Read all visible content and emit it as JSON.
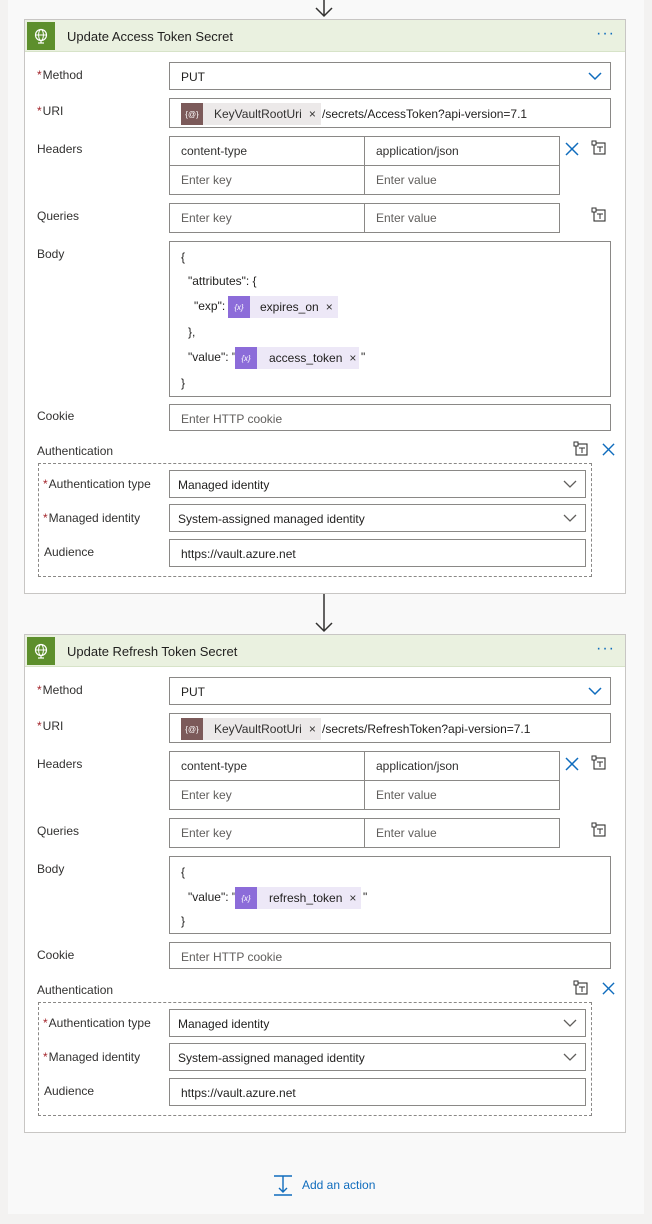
{
  "cards": [
    {
      "title": "Update Access Token Secret",
      "more": "···",
      "method_label": "Method",
      "method_value": "PUT",
      "uri_label": "URI",
      "uri_token": "KeyVaultRootUri",
      "uri_suffix": "/secrets/AccessToken?api-version=7.1",
      "headers_label": "Headers",
      "header_key": "content-type",
      "header_value": "application/json",
      "key_placeholder": "Enter key",
      "value_placeholder": "Enter value",
      "queries_label": "Queries",
      "body_label": "Body",
      "body": {
        "l1": "{",
        "l2": "\"attributes\": {",
        "l3": "\"exp\":",
        "exp_token": "expires_on",
        "l4": "},",
        "l5_prefix": "\"value\": \"",
        "value_token": "access_token",
        "l5_suffix": "\"",
        "l6": "}"
      },
      "cookie_label": "Cookie",
      "cookie_placeholder": "Enter HTTP cookie",
      "auth_label": "Authentication",
      "auth_type_label": "Authentication type",
      "auth_type_value": "Managed identity",
      "managed_identity_label": "Managed identity",
      "managed_identity_value": "System-assigned managed identity",
      "audience_label": "Audience",
      "audience_value": "https://vault.azure.net"
    },
    {
      "title": "Update Refresh Token Secret",
      "more": "···",
      "method_label": "Method",
      "method_value": "PUT",
      "uri_label": "URI",
      "uri_token": "KeyVaultRootUri",
      "uri_suffix": "/secrets/RefreshToken?api-version=7.1",
      "headers_label": "Headers",
      "header_key": "content-type",
      "header_value": "application/json",
      "key_placeholder": "Enter key",
      "value_placeholder": "Enter value",
      "queries_label": "Queries",
      "body_label": "Body",
      "body": {
        "l1": "{",
        "l5_prefix": "\"value\": \"",
        "value_token": "refresh_token",
        "l5_suffix": "\"",
        "l6": "}"
      },
      "cookie_label": "Cookie",
      "cookie_placeholder": "Enter HTTP cookie",
      "auth_label": "Authentication",
      "auth_type_label": "Authentication type",
      "auth_type_value": "Managed identity",
      "managed_identity_label": "Managed identity",
      "managed_identity_value": "System-assigned managed identity",
      "audience_label": "Audience",
      "audience_value": "https://vault.azure.net"
    }
  ],
  "token_remove": "×",
  "add_action_label": "Add an action",
  "colors": {
    "header_bg": "#eaf1e0",
    "header_icon": "#5d8f2c",
    "accent": "#0f6cbd",
    "dynamic_token": "#8c6cd9",
    "param_token": "#7c5a5a"
  }
}
